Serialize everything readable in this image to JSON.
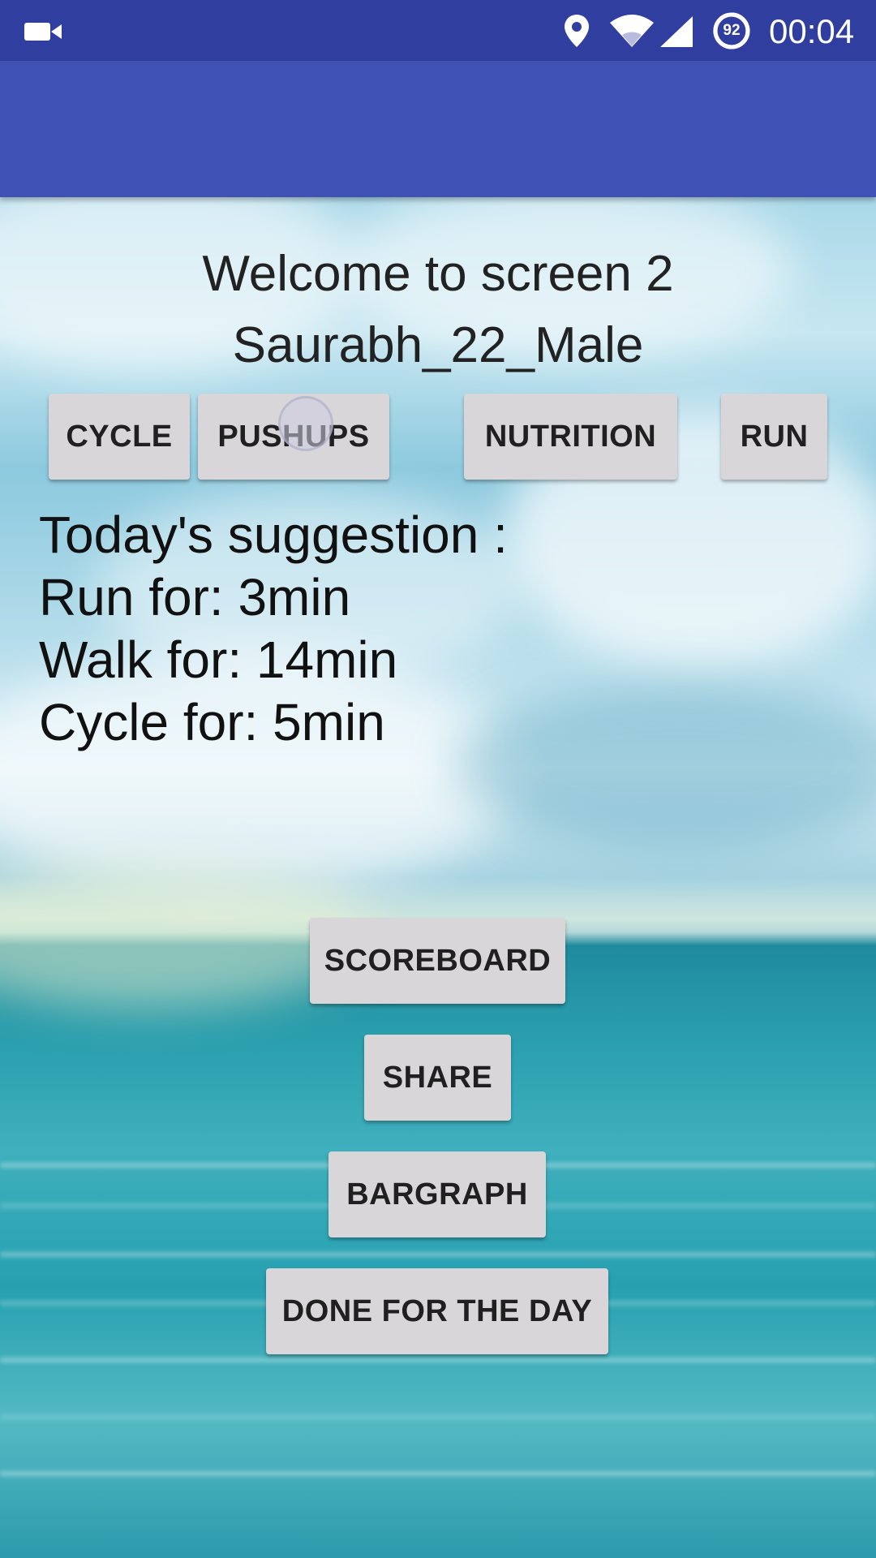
{
  "status_bar": {
    "battery_level": "92",
    "time": "00:04",
    "icons": [
      "camera-icon",
      "location-icon",
      "wifi-icon",
      "signal-icon",
      "battery-icon"
    ]
  },
  "welcome": {
    "line1": "Welcome to screen 2",
    "line2": "Saurabh_22_Male"
  },
  "activity_buttons": {
    "cycle": "CYCLE",
    "pushups": "PUSHUPS",
    "nutrition": "NUTRITION",
    "run": "RUN"
  },
  "suggestion": {
    "title": "Today's suggestion :",
    "run": "Run for: 3min",
    "walk": "Walk for: 14min",
    "cycle": "Cycle for: 5min"
  },
  "action_buttons": {
    "scoreboard": "SCOREBOARD",
    "share": "SHARE",
    "bargraph": "BARGRAPH",
    "done": "DONE FOR THE DAY"
  },
  "colors": {
    "status_bar": "#303f9f",
    "app_bar": "#3f51b5",
    "button": "#d8d6d8"
  }
}
